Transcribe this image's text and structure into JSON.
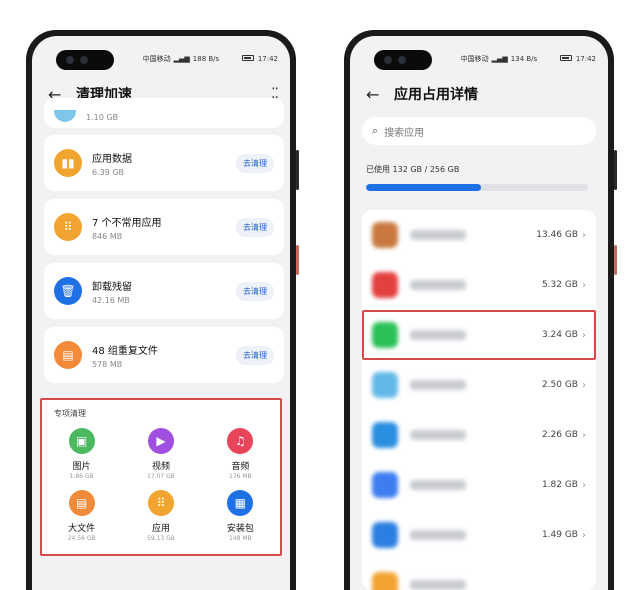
{
  "left": {
    "status": {
      "carrier": "中国移动",
      "speed": "188 B/s",
      "time": "17:42"
    },
    "title": "清理加速",
    "prev_size": "1.10 GB",
    "cards": [
      {
        "name": "应用数据",
        "size": "6.39 GB",
        "button": "去清理",
        "icon": "chart-icon",
        "color": "#f2a431"
      },
      {
        "name": "7 个不常用应用",
        "size": "846 MB",
        "button": "去清理",
        "icon": "apps-icon",
        "color": "#f2a431"
      },
      {
        "name": "卸载残留",
        "size": "42.16 MB",
        "button": "去清理",
        "icon": "trash-icon",
        "color": "#1f6fe5"
      },
      {
        "name": "48 组重复文件",
        "size": "578 MB",
        "button": "去清理",
        "icon": "file-icon",
        "color": "#f28a3a"
      }
    ],
    "special": {
      "heading": "专项清理",
      "items": [
        {
          "name": "图片",
          "size": "1.86 GB",
          "icon": "image-icon",
          "color": "#4cb860"
        },
        {
          "name": "视频",
          "size": "17.07 GB",
          "icon": "video-icon",
          "color": "#a04fe0"
        },
        {
          "name": "音频",
          "size": "176 MB",
          "icon": "music-icon",
          "color": "#e8445a"
        },
        {
          "name": "大文件",
          "size": "24.56 GB",
          "icon": "doc-icon",
          "color": "#f28a3a"
        },
        {
          "name": "应用",
          "size": "59.13 GB",
          "icon": "apps-icon",
          "color": "#f2a431"
        },
        {
          "name": "安装包",
          "size": "148 MB",
          "icon": "package-icon",
          "color": "#1f6fe5"
        }
      ]
    }
  },
  "right": {
    "status": {
      "carrier": "中国移动",
      "speed": "134 B/s",
      "time": "17:42"
    },
    "title": "应用占用详情",
    "search_placeholder": "搜索应用",
    "usage_text": "已使用 132 GB / 256 GB",
    "usage_fraction": 0.516,
    "apps": [
      {
        "size": "13.46 GB",
        "color": "#c9793f",
        "highlight": false
      },
      {
        "size": "5.32 GB",
        "color": "#e34040",
        "highlight": false
      },
      {
        "size": "3.24 GB",
        "color": "#2cc158",
        "highlight": true
      },
      {
        "size": "2.50 GB",
        "color": "#62b8e8",
        "highlight": false
      },
      {
        "size": "2.26 GB",
        "color": "#2a8fe0",
        "highlight": false
      },
      {
        "size": "1.82 GB",
        "color": "#3d7df0",
        "highlight": false
      },
      {
        "size": "1.49 GB",
        "color": "#2b7fe0",
        "highlight": false
      },
      {
        "size": "",
        "color": "#f2a431",
        "highlight": false
      }
    ]
  }
}
